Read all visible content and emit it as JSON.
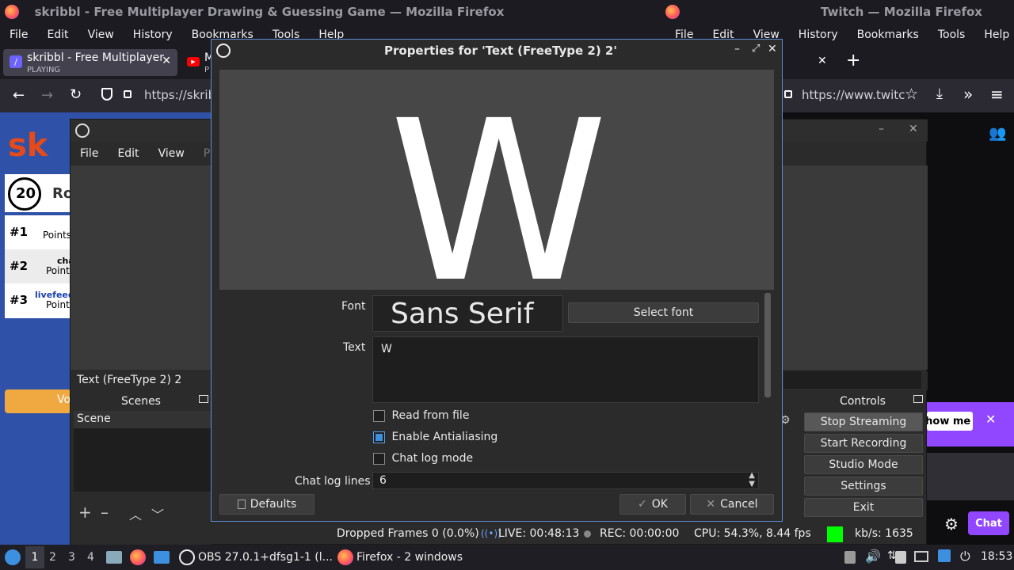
{
  "firefox_left": {
    "title": "skribbl - Free Multiplayer Drawing & Guessing Game — Mozilla Firefox",
    "menu": [
      "File",
      "Edit",
      "View",
      "History",
      "Bookmarks",
      "Tools",
      "Help"
    ],
    "tab1_label": "skribbl - Free Multiplayer",
    "tab1_sub": "PLAYING",
    "tab2_label": "M",
    "tab2_sub": "P",
    "url": "https://skrib"
  },
  "firefox_right": {
    "title": "Twitch — Mozilla Firefox",
    "menu": [
      "File",
      "Edit",
      "View",
      "History",
      "Bookmarks",
      "Tools",
      "Help"
    ],
    "url": "https://www.twitc",
    "show_me": "Show me",
    "chat": "Chat"
  },
  "skribbl": {
    "timer": "20",
    "round": "Ro",
    "players": [
      {
        "rank": "#1",
        "name": "",
        "points": "Points"
      },
      {
        "rank": "#2",
        "name": "cha",
        "points": "Points"
      },
      {
        "rank": "#3",
        "name": "livefeed",
        "points": "Points"
      }
    ],
    "vote": "Vo"
  },
  "obs": {
    "menu": [
      "File",
      "Edit",
      "View",
      "Pro"
    ],
    "source_label": "Text (FreeType 2) 2",
    "scenes_title": "Scenes",
    "scene_item": "Scene",
    "controls_title": "Controls",
    "controls": [
      "Stop Streaming",
      "Start Recording",
      "Studio Mode",
      "Settings",
      "Exit"
    ],
    "status": {
      "dropped": "Dropped Frames 0 (0.0%)",
      "live": "LIVE: 00:48:13",
      "rec": "REC: 00:00:00",
      "cpu": "CPU: 54.3%, 8.44 fps",
      "kbs": "kb/s: 1635"
    }
  },
  "dialog": {
    "title": "Properties for 'Text (FreeType 2) 2'",
    "preview_text": "W",
    "font_label": "Font",
    "font_value": "Sans Serif",
    "select_font": "Select font",
    "text_label": "Text",
    "text_value": "W",
    "read_from_file": "Read from file",
    "antialiasing": "Enable Antialiasing",
    "chat_log_mode": "Chat log mode",
    "chat_log_lines_label": "Chat log lines",
    "chat_log_lines_value": "6",
    "defaults": "Defaults",
    "ok": "OK",
    "cancel": "Cancel"
  },
  "taskbar": {
    "workspaces": [
      "1",
      "2",
      "3",
      "4"
    ],
    "obs_task": "OBS 27.0.1+dfsg1-1 (l...",
    "firefox_task": "Firefox - 2 windows",
    "clock": "18:53"
  },
  "colors": {
    "accent_blue": "#3d8fe0",
    "twitch_purple": "#9147ff",
    "live_green": "#00ff00"
  }
}
